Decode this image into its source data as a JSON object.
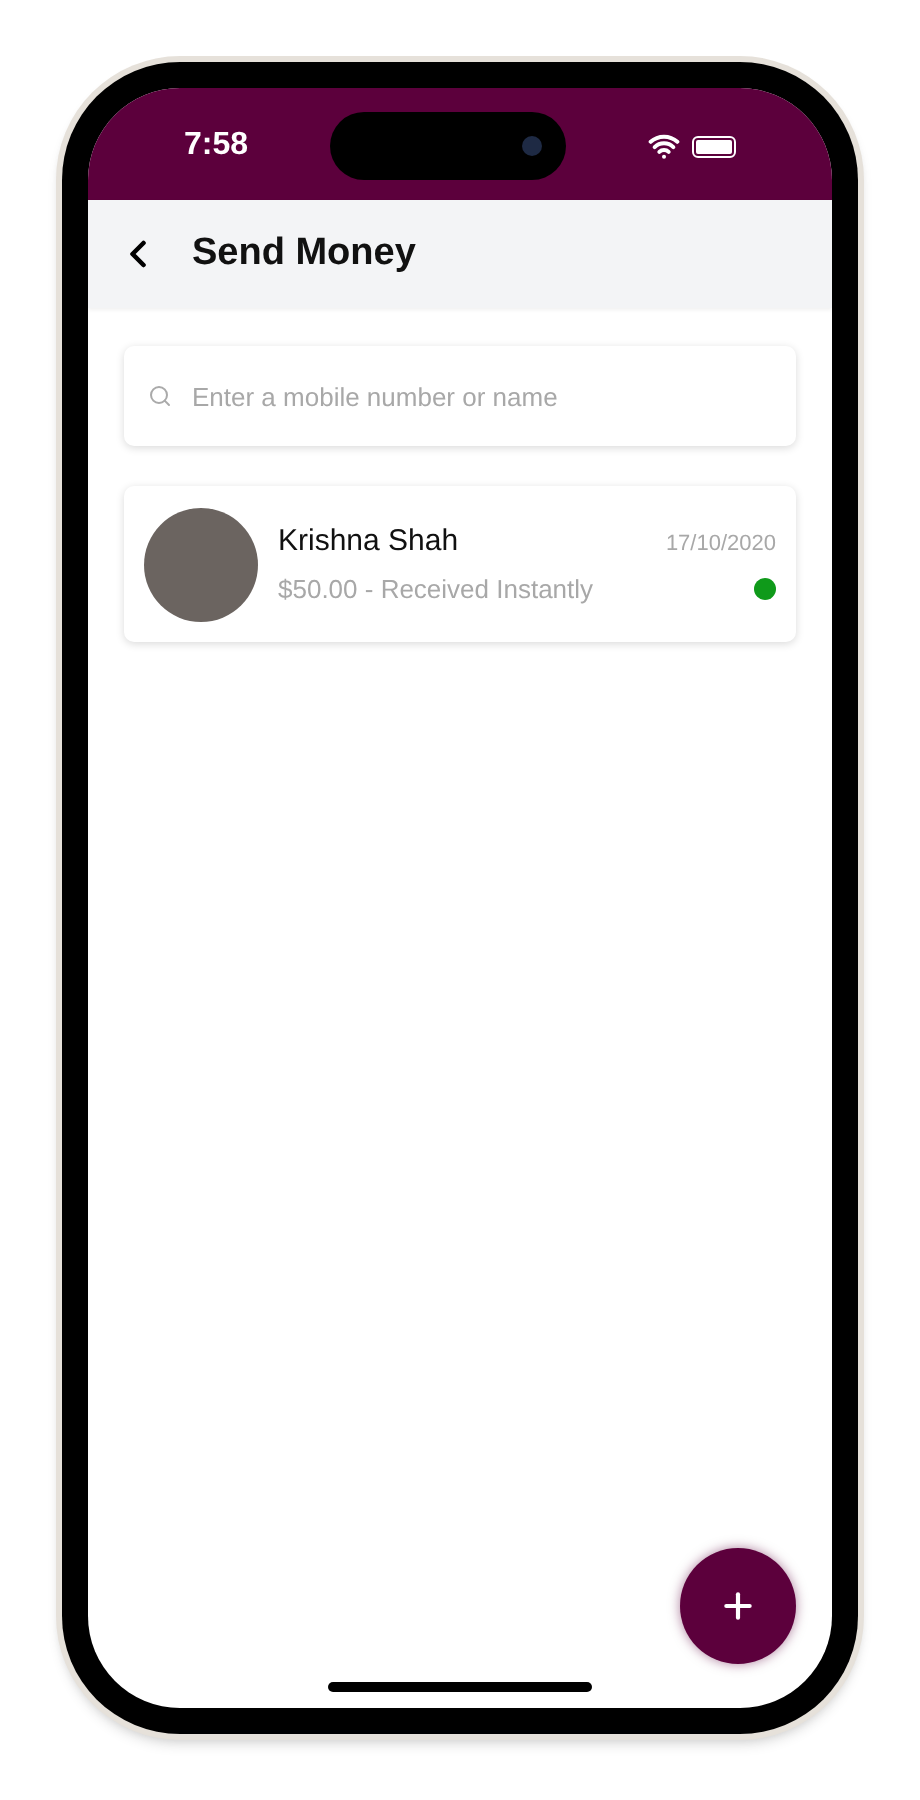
{
  "status_bar": {
    "time": "7:58"
  },
  "header": {
    "title": "Send Money"
  },
  "search": {
    "placeholder": "Enter a mobile number or name"
  },
  "transactions": [
    {
      "name": "Krishna Shah",
      "detail": "$50.00 - Received Instantly",
      "date": "17/10/2020",
      "color": "#0f9a1a"
    }
  ]
}
